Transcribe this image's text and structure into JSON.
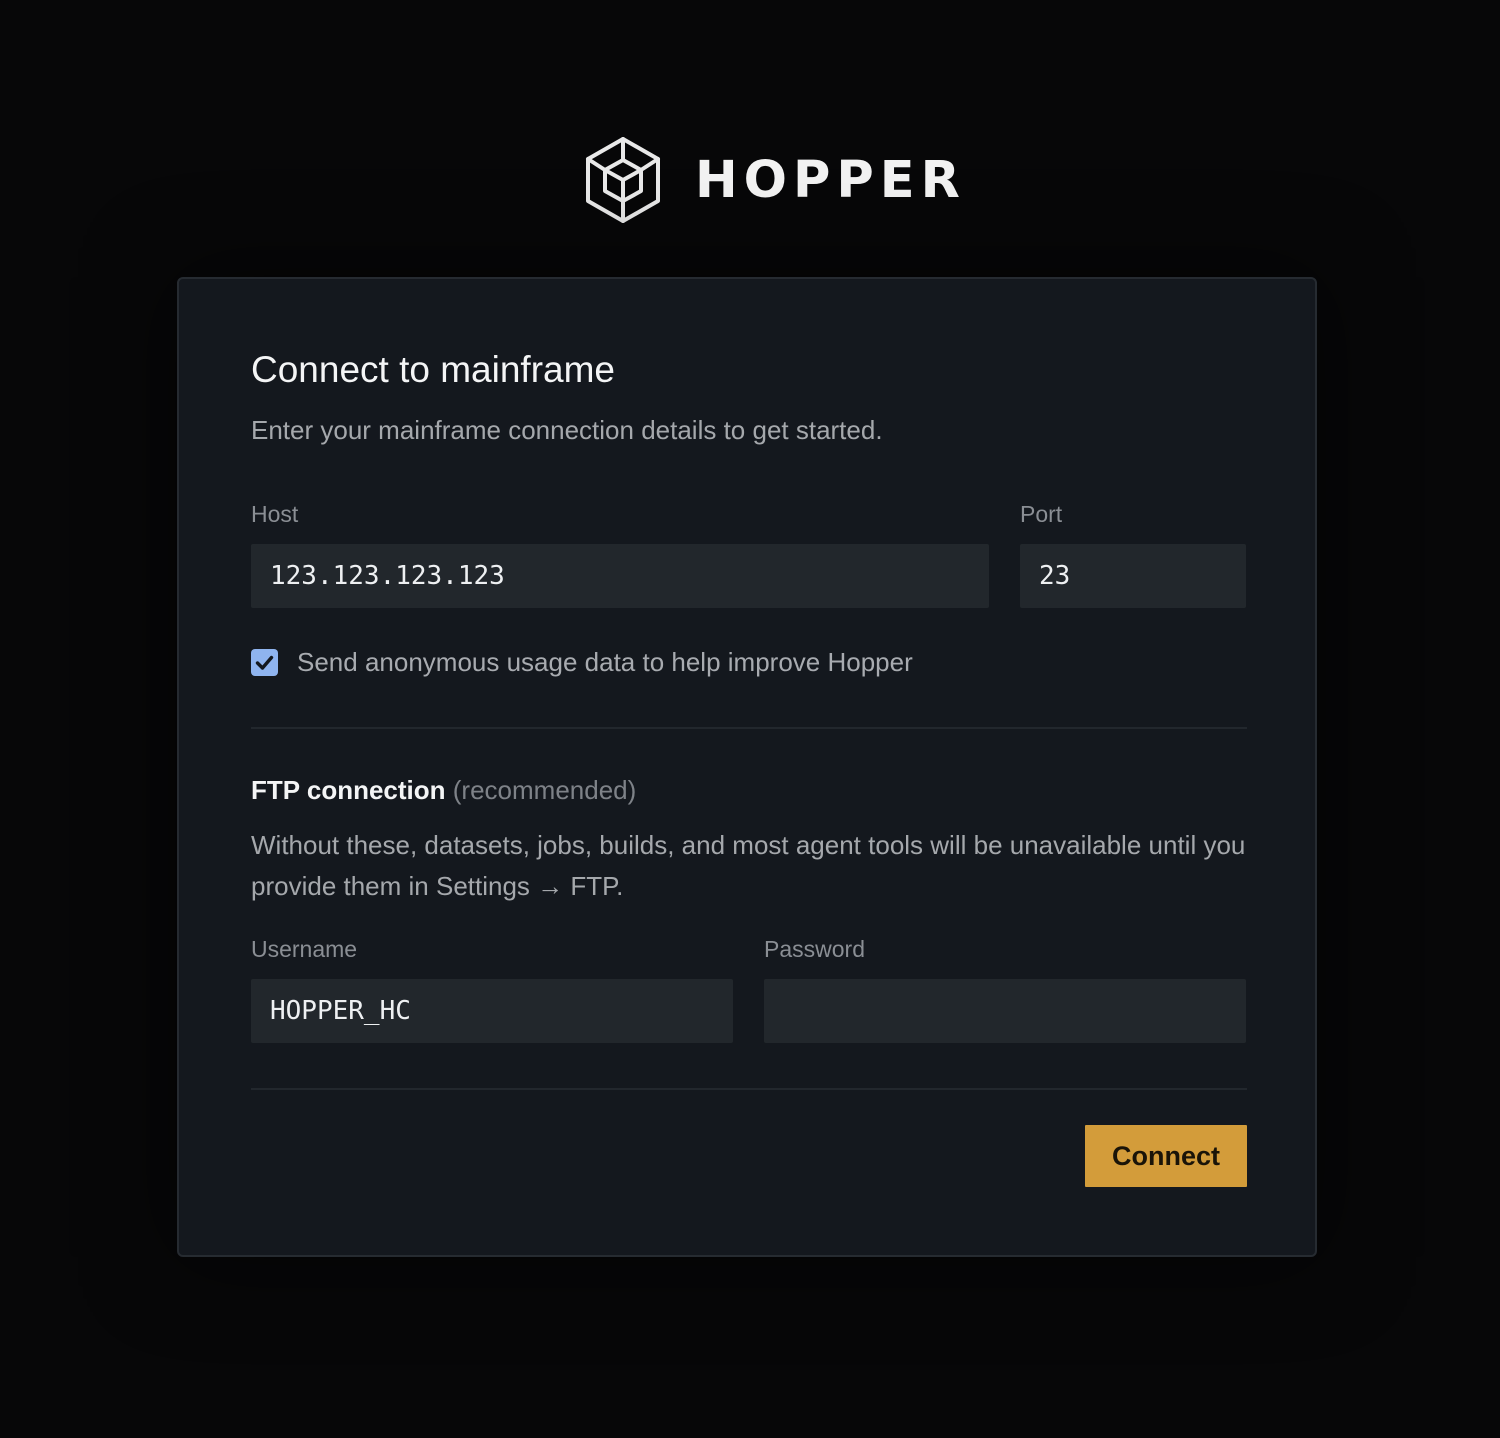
{
  "brand": {
    "name": "HOPPER",
    "icon": "isometric-cube-icon"
  },
  "form": {
    "title": "Connect to mainframe",
    "subtitle": "Enter your mainframe connection details to get started.",
    "host": {
      "label": "Host",
      "value": "123.123.123.123"
    },
    "port": {
      "label": "Port",
      "value": "23"
    },
    "telemetry": {
      "checked": true,
      "label": "Send anonymous usage data to help improve Hopper"
    },
    "ftp": {
      "title": "FTP connection",
      "hint": "(recommended)",
      "description": "Without these, datasets, jobs, builds, and most agent tools will be unavailable until you provide them in Settings → FTP.",
      "username": {
        "label": "Username",
        "value": "HOPPER_HC"
      },
      "password": {
        "label": "Password",
        "value": ""
      }
    },
    "submit_label": "Connect"
  },
  "colors": {
    "background": "#070708",
    "card": "#14181e",
    "field": "#22272c",
    "accent": "#d39c3a",
    "checkbox": "#8fb4ef"
  }
}
